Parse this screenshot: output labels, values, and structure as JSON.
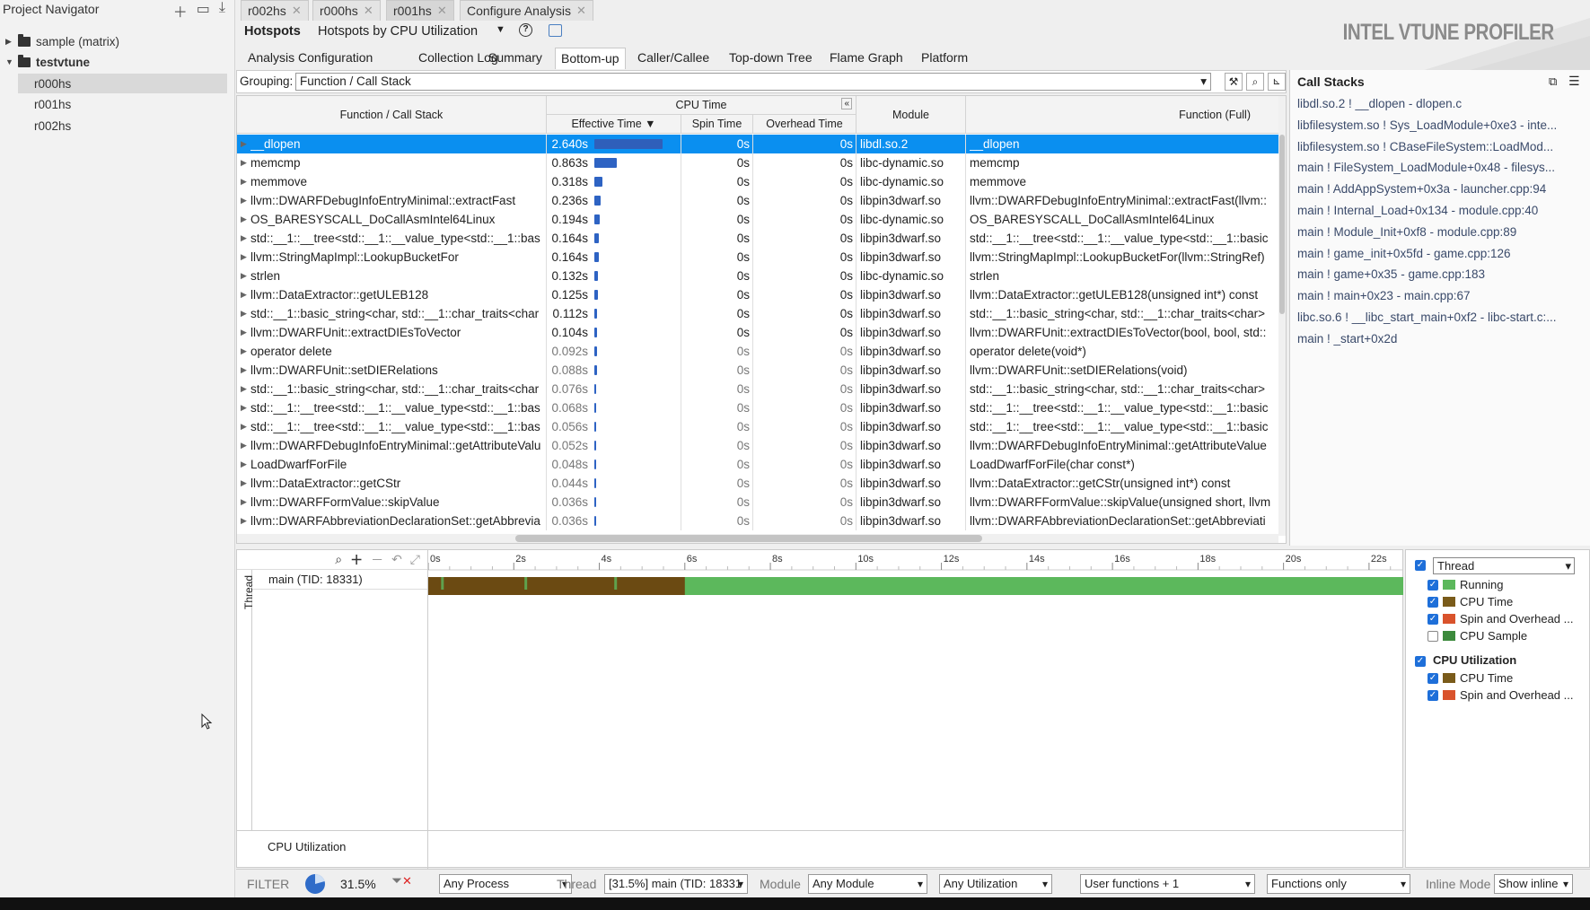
{
  "navigator": {
    "title": "Project Navigator",
    "items": [
      {
        "label": "sample (matrix)",
        "expanded": false
      },
      {
        "label": "testvtune",
        "expanded": true
      },
      {
        "label": "r000hs",
        "selected": true
      },
      {
        "label": "r001hs"
      },
      {
        "label": "r002hs"
      }
    ]
  },
  "tabs": [
    {
      "label": "r002hs"
    },
    {
      "label": "r000hs"
    },
    {
      "label": "r001hs",
      "active": true
    },
    {
      "label": "Configure Analysis"
    }
  ],
  "analysis": {
    "name": "Hotspots",
    "type": "Hotspots by CPU Utilization",
    "brand": "INTEL VTUNE PROFILER"
  },
  "subtabs": [
    "Analysis Configuration",
    "Collection Log",
    "Summary",
    "Bottom-up",
    "Caller/Callee",
    "Top-down Tree",
    "Flame Graph",
    "Platform"
  ],
  "subtab_active": "Bottom-up",
  "grouping": {
    "label": "Grouping:",
    "value": "Function / Call Stack"
  },
  "grid": {
    "headers": {
      "function": "Function / Call Stack",
      "cpu_time": "CPU Time",
      "effective": "Effective Time ▼",
      "spin": "Spin Time",
      "overhead": "Overhead Time",
      "module": "Module",
      "full": "Function (Full)"
    },
    "rows": [
      {
        "fn": "__dlopen",
        "eff": "2.640s",
        "frac": 1.0,
        "spin": "0s",
        "ovh": "0s",
        "mod": "libdl.so.2",
        "full": "__dlopen",
        "sel": true
      },
      {
        "fn": "memcmp",
        "eff": "0.863s",
        "frac": 0.327,
        "spin": "0s",
        "ovh": "0s",
        "mod": "libc-dynamic.so",
        "full": "memcmp"
      },
      {
        "fn": "memmove",
        "eff": "0.318s",
        "frac": 0.12,
        "spin": "0s",
        "ovh": "0s",
        "mod": "libc-dynamic.so",
        "full": "memmove"
      },
      {
        "fn": "llvm::DWARFDebugInfoEntryMinimal::extractFast",
        "eff": "0.236s",
        "frac": 0.089,
        "spin": "0s",
        "ovh": "0s",
        "mod": "libpin3dwarf.so",
        "full": "llvm::DWARFDebugInfoEntryMinimal::extractFast(llvm::"
      },
      {
        "fn": "OS_BARESYSCALL_DoCallAsmIntel64Linux",
        "eff": "0.194s",
        "frac": 0.073,
        "spin": "0s",
        "ovh": "0s",
        "mod": "libc-dynamic.so",
        "full": "OS_BARESYSCALL_DoCallAsmIntel64Linux"
      },
      {
        "fn": "std::__1::__tree<std::__1::__value_type<std::__1::bas",
        "eff": "0.164s",
        "frac": 0.062,
        "spin": "0s",
        "ovh": "0s",
        "mod": "libpin3dwarf.so",
        "full": "std::__1::__tree<std::__1::__value_type<std::__1::basic"
      },
      {
        "fn": "llvm::StringMapImpl::LookupBucketFor",
        "eff": "0.164s",
        "frac": 0.062,
        "spin": "0s",
        "ovh": "0s",
        "mod": "libpin3dwarf.so",
        "full": "llvm::StringMapImpl::LookupBucketFor(llvm::StringRef)"
      },
      {
        "fn": "strlen",
        "eff": "0.132s",
        "frac": 0.05,
        "spin": "0s",
        "ovh": "0s",
        "mod": "libc-dynamic.so",
        "full": "strlen"
      },
      {
        "fn": "llvm::DataExtractor::getULEB128",
        "eff": "0.125s",
        "frac": 0.047,
        "spin": "0s",
        "ovh": "0s",
        "mod": "libpin3dwarf.so",
        "full": "llvm::DataExtractor::getULEB128(unsigned int*) const"
      },
      {
        "fn": "std::__1::basic_string<char, std::__1::char_traits<char",
        "eff": "0.112s",
        "frac": 0.042,
        "spin": "0s",
        "ovh": "0s",
        "mod": "libpin3dwarf.so",
        "full": "std::__1::basic_string<char, std::__1::char_traits<char>"
      },
      {
        "fn": "llvm::DWARFUnit::extractDIEsToVector",
        "eff": "0.104s",
        "frac": 0.039,
        "spin": "0s",
        "ovh": "0s",
        "mod": "libpin3dwarf.so",
        "full": "llvm::DWARFUnit::extractDIEsToVector(bool, bool, std::"
      },
      {
        "fn": "operator delete",
        "eff": "0.092s",
        "frac": 0.035,
        "spin": "0s",
        "ovh": "0s",
        "mod": "libpin3dwarf.so",
        "full": "operator delete(void*)",
        "dim": true
      },
      {
        "fn": "llvm::DWARFUnit::setDIERelations",
        "eff": "0.088s",
        "frac": 0.033,
        "spin": "0s",
        "ovh": "0s",
        "mod": "libpin3dwarf.so",
        "full": "llvm::DWARFUnit::setDIERelations(void)",
        "dim": true
      },
      {
        "fn": "std::__1::basic_string<char, std::__1::char_traits<char",
        "eff": "0.076s",
        "frac": 0.029,
        "spin": "0s",
        "ovh": "0s",
        "mod": "libpin3dwarf.so",
        "full": "std::__1::basic_string<char, std::__1::char_traits<char>",
        "dim": true
      },
      {
        "fn": "std::__1::__tree<std::__1::__value_type<std::__1::bas",
        "eff": "0.068s",
        "frac": 0.026,
        "spin": "0s",
        "ovh": "0s",
        "mod": "libpin3dwarf.so",
        "full": "std::__1::__tree<std::__1::__value_type<std::__1::basic",
        "dim": true
      },
      {
        "fn": "std::__1::__tree<std::__1::__value_type<std::__1::bas",
        "eff": "0.056s",
        "frac": 0.021,
        "spin": "0s",
        "ovh": "0s",
        "mod": "libpin3dwarf.so",
        "full": "std::__1::__tree<std::__1::__value_type<std::__1::basic",
        "dim": true
      },
      {
        "fn": "llvm::DWARFDebugInfoEntryMinimal::getAttributeValu",
        "eff": "0.052s",
        "frac": 0.02,
        "spin": "0s",
        "ovh": "0s",
        "mod": "libpin3dwarf.so",
        "full": "llvm::DWARFDebugInfoEntryMinimal::getAttributeValue",
        "dim": true
      },
      {
        "fn": "LoadDwarfForFile",
        "eff": "0.048s",
        "frac": 0.018,
        "spin": "0s",
        "ovh": "0s",
        "mod": "libpin3dwarf.so",
        "full": "LoadDwarfForFile(char const*)",
        "dim": true
      },
      {
        "fn": "llvm::DataExtractor::getCStr",
        "eff": "0.044s",
        "frac": 0.017,
        "spin": "0s",
        "ovh": "0s",
        "mod": "libpin3dwarf.so",
        "full": "llvm::DataExtractor::getCStr(unsigned int*) const",
        "dim": true
      },
      {
        "fn": "llvm::DWARFFormValue::skipValue",
        "eff": "0.036s",
        "frac": 0.014,
        "spin": "0s",
        "ovh": "0s",
        "mod": "libpin3dwarf.so",
        "full": "llvm::DWARFFormValue::skipValue(unsigned short, llvm",
        "dim": true
      },
      {
        "fn": "llvm::DWARFAbbreviationDeclarationSet::getAbbrevia",
        "eff": "0.036s",
        "frac": 0.014,
        "spin": "0s",
        "ovh": "0s",
        "mod": "libpin3dwarf.so",
        "full": "llvm::DWARFAbbreviationDeclarationSet::getAbbreviati",
        "dim": true
      }
    ]
  },
  "callstacks": {
    "title": "Call Stacks",
    "items": [
      "libdl.so.2 ! __dlopen - dlopen.c",
      "libfilesystem.so ! Sys_LoadModule+0xe3 - inte...",
      "libfilesystem.so ! CBaseFileSystem::LoadMod...",
      "main ! FileSystem_LoadModule+0x48 - filesys...",
      "main ! AddAppSystem+0x3a - launcher.cpp:94",
      "main ! Internal_Load+0x134 - module.cpp:40",
      "main ! Module_Init+0xf8 - module.cpp:89",
      "main ! game_init+0x5fd - game.cpp:126",
      "main ! game+0x35 - game.cpp:183",
      "main ! main+0x23 - main.cpp:67",
      "libc.so.6 ! __libc_start_main+0xf2 - libc-start.c:...",
      "main ! _start+0x2d"
    ]
  },
  "timeline": {
    "ticks": [
      "0s",
      "2s",
      "4s",
      "6s",
      "8s",
      "10s",
      "12s",
      "14s",
      "16s",
      "18s",
      "20s",
      "22s"
    ],
    "axis_max_s": 22.8,
    "side_label": "Thread",
    "thread": "main (TID: 18331)",
    "cpu_util_label": "CPU Utilization",
    "cpu_active_until_s": 6.0,
    "colors": {
      "running": "#5cb85c",
      "cpu": "#6b4a12"
    }
  },
  "legend": {
    "group": "Thread",
    "items": [
      {
        "label": "Running",
        "checked": true,
        "swatch": "#5cb85c"
      },
      {
        "label": "CPU Time",
        "checked": true,
        "swatch": "#7a5b1a"
      },
      {
        "label": "Spin and Overhead ...",
        "checked": true,
        "swatch": "#d9532c"
      },
      {
        "label": "CPU Sample",
        "checked": false,
        "swatch": "#3c8a3c"
      }
    ],
    "group2": "CPU Utilization",
    "items2": [
      {
        "label": "CPU Time",
        "checked": true,
        "swatch": "#7a5b1a"
      },
      {
        "label": "Spin and Overhead ...",
        "checked": true,
        "swatch": "#d9532c"
      }
    ]
  },
  "filter": {
    "label": "FILTER",
    "percent": "31.5%",
    "process": "Any Process",
    "thread_label": "Thread",
    "thread": "[31.5%] main (TID: 18331",
    "module_label": "Module",
    "module": "Any Module",
    "utilization": "Any Utilization",
    "user_functions": "User functions + 1",
    "functions_only": "Functions only",
    "inline_label": "Inline Mode",
    "inline": "Show inline"
  }
}
